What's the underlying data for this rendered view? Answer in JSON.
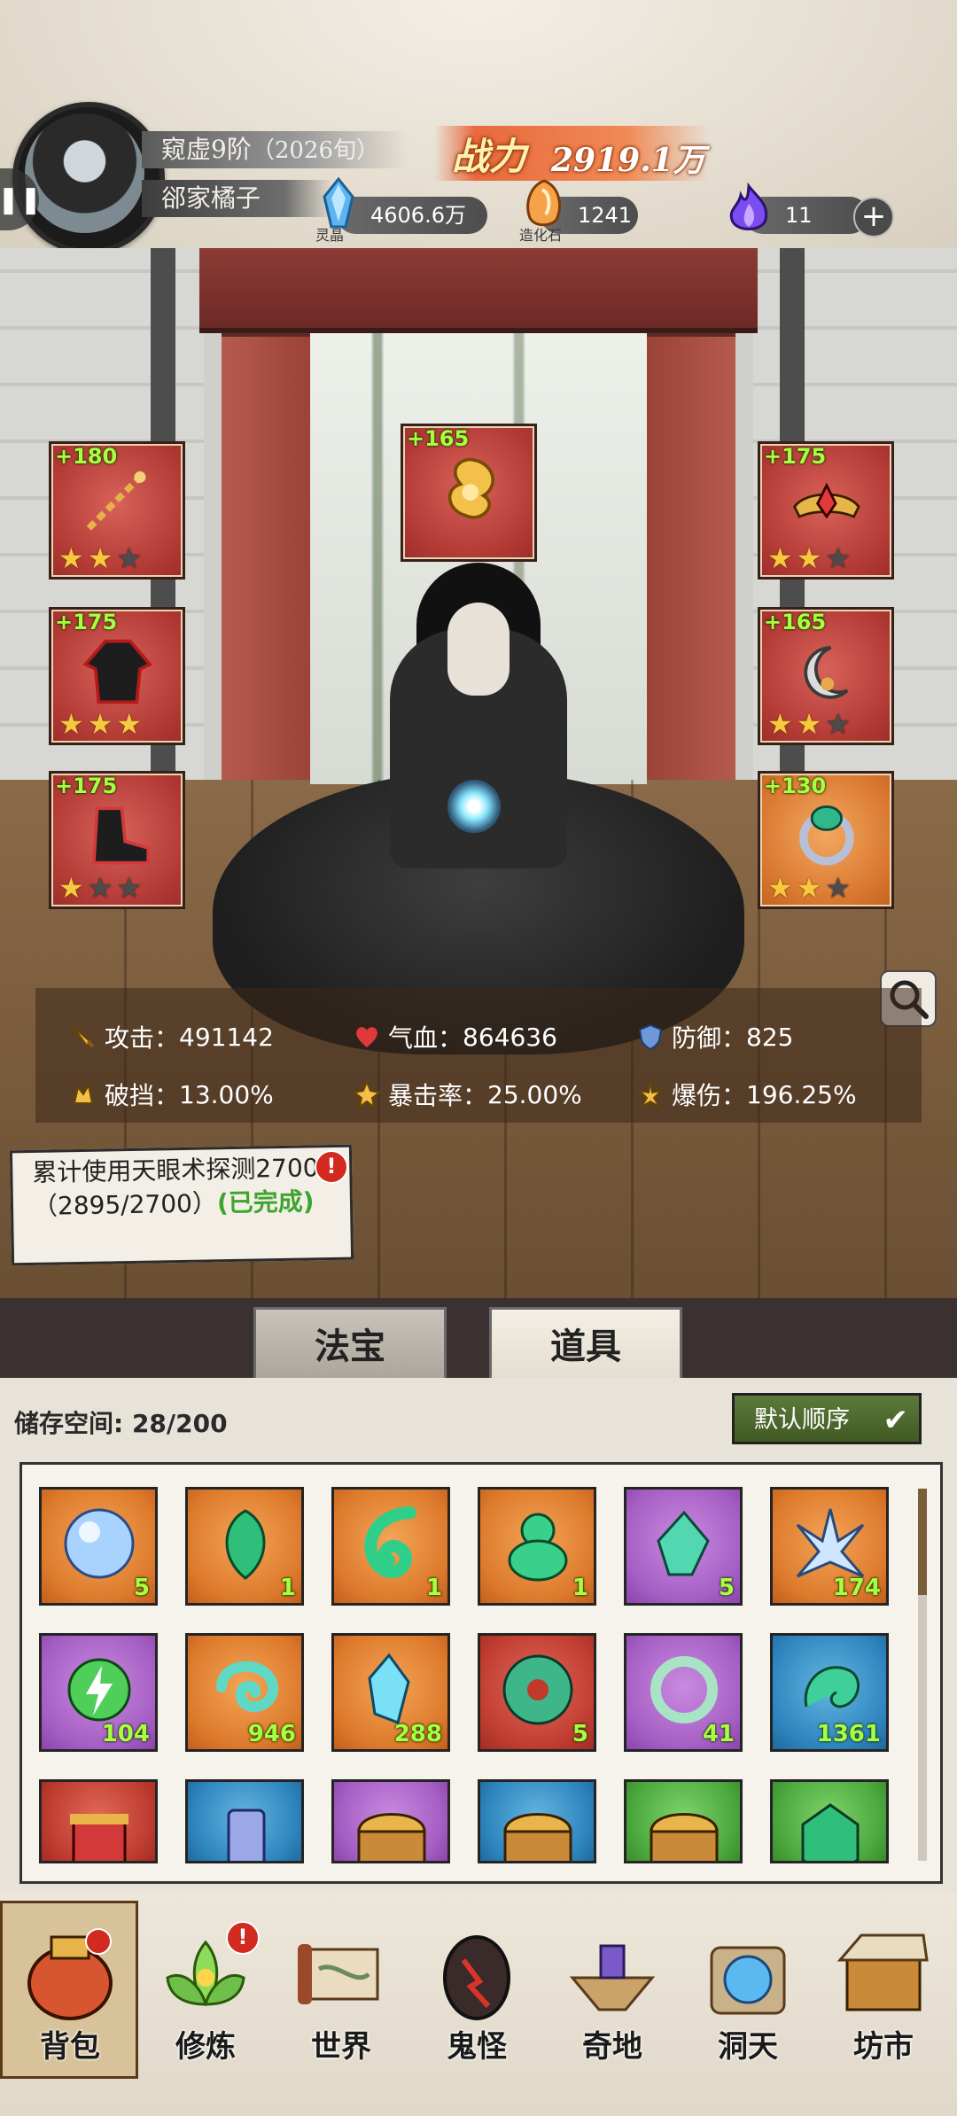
{
  "player": {
    "realm": "窥虚9阶",
    "age": "（2026旬）",
    "name": "郤家橘子",
    "power_label": "战力",
    "power_value": "2919.1万"
  },
  "resources": [
    {
      "name": "灵晶",
      "value": "4606.6万",
      "icon": "blue-crystal-icon"
    },
    {
      "name": "造化石",
      "value": "1241",
      "icon": "orange-stone-icon"
    },
    {
      "name": "",
      "value": "11",
      "icon": "purple-flame-icon"
    }
  ],
  "equipment": [
    {
      "bonus": "+180",
      "stars": 2,
      "frame": "red",
      "icon": "chain-weapon-icon"
    },
    {
      "bonus": "+165",
      "stars": 0,
      "frame": "red",
      "icon": "golden-cloud-treasure-icon"
    },
    {
      "bonus": "+175",
      "stars": 2,
      "frame": "red",
      "icon": "crown-headband-icon"
    },
    {
      "bonus": "+175",
      "stars": 3,
      "frame": "red",
      "icon": "black-robe-icon"
    },
    {
      "bonus": "+165",
      "stars": 2,
      "frame": "red",
      "icon": "moon-pendant-icon"
    },
    {
      "bonus": "+175",
      "stars": 1,
      "frame": "red",
      "icon": "black-boots-icon"
    },
    {
      "bonus": "+130",
      "stars": 2,
      "frame": "orange",
      "icon": "jade-ring-icon"
    }
  ],
  "stats": [
    {
      "label": "攻击：",
      "value": "491142",
      "icon": "sword-icon"
    },
    {
      "label": "气血：",
      "value": "864636",
      "icon": "heart-icon"
    },
    {
      "label": "防御：",
      "value": "825",
      "icon": "shield-icon"
    },
    {
      "label": "破挡：",
      "value": "13.00%",
      "icon": "break-icon"
    },
    {
      "label": "暴击率：",
      "value": "25.00%",
      "icon": "crit-icon"
    },
    {
      "label": "爆伤：",
      "value": "196.25%",
      "icon": "crit-damage-icon"
    }
  ],
  "quest": {
    "text": "累计使用天眼术探测2700次（2895/2700）",
    "status": "(已完成)",
    "badge": "!"
  },
  "tabs": [
    "法宝",
    "道具"
  ],
  "active_tab": "道具",
  "bag": {
    "storage_label": "储存空间:",
    "storage_value": "28/200",
    "sort_label": "默认顺序",
    "items": [
      {
        "color": "orange",
        "count": "5",
        "icon": "crystal-orb-icon"
      },
      {
        "color": "orange",
        "count": "1",
        "icon": "jade-leaf-icon"
      },
      {
        "color": "orange",
        "count": "1",
        "icon": "green-swirl-icon"
      },
      {
        "color": "orange",
        "count": "1",
        "icon": "jade-gourd-icon"
      },
      {
        "color": "purple",
        "count": "5",
        "icon": "green-crystal-icon"
      },
      {
        "color": "orange",
        "count": "174",
        "icon": "ice-crystal-icon"
      },
      {
        "color": "purple",
        "count": "104",
        "icon": "lightning-orb-icon"
      },
      {
        "color": "orange",
        "count": "946",
        "icon": "wind-swirl-icon"
      },
      {
        "color": "orange",
        "count": "288",
        "icon": "blue-crystal-shard-icon"
      },
      {
        "color": "red",
        "count": "5",
        "icon": "jade-disc-icon"
      },
      {
        "color": "purple",
        "count": "41",
        "icon": "jade-bracelet-icon"
      },
      {
        "color": "blue",
        "count": "1361",
        "icon": "jade-beast-icon"
      },
      {
        "color": "red",
        "count": "",
        "icon": "red-scroll-icon"
      },
      {
        "color": "blue",
        "count": "",
        "icon": "blue-talisman-icon"
      },
      {
        "color": "purple",
        "count": "",
        "icon": "treasure-chest-icon"
      },
      {
        "color": "blue",
        "count": "",
        "icon": "treasure-chest-icon"
      },
      {
        "color": "green",
        "count": "",
        "icon": "treasure-chest-icon"
      },
      {
        "color": "green",
        "count": "",
        "icon": "green-gem-icon"
      }
    ]
  },
  "nav": [
    {
      "label": "背包",
      "icon": "bag-icon",
      "badge": false,
      "active": true
    },
    {
      "label": "修炼",
      "icon": "lotus-icon",
      "badge": true,
      "active": false
    },
    {
      "label": "世界",
      "icon": "scroll-map-icon",
      "badge": false,
      "active": false
    },
    {
      "label": "鬼怪",
      "icon": "demon-egg-icon",
      "badge": false,
      "active": false
    },
    {
      "label": "奇地",
      "icon": "floating-island-icon",
      "badge": false,
      "active": false
    },
    {
      "label": "洞天",
      "icon": "portal-icon",
      "badge": false,
      "active": false
    },
    {
      "label": "坊市",
      "icon": "market-stall-icon",
      "badge": false,
      "active": false
    }
  ],
  "colors": {
    "bonus_green": "#a6ff3f",
    "star_gold": "#f7c940",
    "power_orange": "#e86a3c",
    "sort_button_green": "#4e6a2f"
  }
}
